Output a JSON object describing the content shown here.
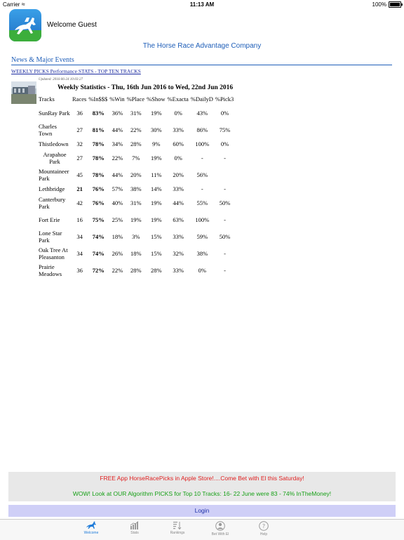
{
  "status_bar": {
    "carrier": "Carrier",
    "time": "11:13 AM",
    "battery": "100%"
  },
  "header": {
    "welcome": "Welcome Guest",
    "company": "The Horse Race Advantage Company"
  },
  "news": {
    "section_title": "News & Major Events",
    "link": "WEEKLY PICKS Performance STATS - TOP TEN TRACKS",
    "updated": "Updated: 2016-06-24 10:03:27",
    "stats_title": "Weekly Statistics - Thu, 16th Jun 2016 to Wed, 22nd Jun 2016"
  },
  "table": {
    "headers": [
      "Tracks",
      "Races",
      "%In$$$",
      "%Win",
      "%Place",
      "%Show",
      "%Exacta",
      "%DailyD",
      "%Pick3"
    ],
    "rows": [
      [
        "SunRay Park",
        "36",
        "83%",
        "36%",
        "31%",
        "19%",
        "0%",
        "43%",
        "0%"
      ],
      [
        "Charles Town",
        "27",
        "81%",
        "44%",
        "22%",
        "30%",
        "33%",
        "86%",
        "75%"
      ],
      [
        "Thistledown",
        "32",
        "78%",
        "34%",
        "28%",
        "9%",
        "60%",
        "100%",
        "0%"
      ],
      [
        "Arapahoe Park",
        "27",
        "78%",
        "22%",
        "7%",
        "19%",
        "0%",
        "-",
        "-"
      ],
      [
        "Mountaineer Park",
        "45",
        "78%",
        "44%",
        "20%",
        "11%",
        "20%",
        "56%",
        ""
      ],
      [
        "Lethbridge",
        "21",
        "76%",
        "57%",
        "38%",
        "14%",
        "33%",
        "-",
        "-"
      ],
      [
        "Canterbury Park",
        "42",
        "76%",
        "40%",
        "31%",
        "19%",
        "44%",
        "55%",
        "50%"
      ],
      [
        "Fort Erie",
        "16",
        "75%",
        "25%",
        "19%",
        "19%",
        "63%",
        "100%",
        "-"
      ],
      [
        "Lone Star Park",
        "34",
        "74%",
        "18%",
        "3%",
        "15%",
        "33%",
        "59%",
        "50%"
      ],
      [
        "Oak Tree At Pleasanton",
        "34",
        "74%",
        "26%",
        "18%",
        "15%",
        "32%",
        "38%",
        "-"
      ],
      [
        "Prairie Meadows",
        "36",
        "72%",
        "22%",
        "28%",
        "28%",
        "33%",
        "0%",
        "-"
      ]
    ]
  },
  "banner": {
    "line1": "FREE App HorseRacePicks in Apple Store!....Come Bet with El this Saturday!",
    "line2": "WOW! Look at OUR Algorithm PICKS for Top 10 Tracks: 16- 22 June were 83 - 74% InTheMoney!"
  },
  "login_label": "Login",
  "tabs": [
    {
      "label": "Welcome",
      "icon": "horse-icon",
      "active": true
    },
    {
      "label": "Stats",
      "icon": "bar-chart-icon",
      "active": false
    },
    {
      "label": "Rankings",
      "icon": "sort-icon",
      "active": false
    },
    {
      "label": "Bet With El",
      "icon": "person-icon",
      "active": false
    },
    {
      "label": "Help",
      "icon": "question-icon",
      "active": false
    }
  ],
  "colors": {
    "accent": "#1e7bd9",
    "link": "#1e5eb8",
    "promo_red": "#e02020",
    "promo_green": "#18a018",
    "login_bg": "#cfcff7"
  }
}
